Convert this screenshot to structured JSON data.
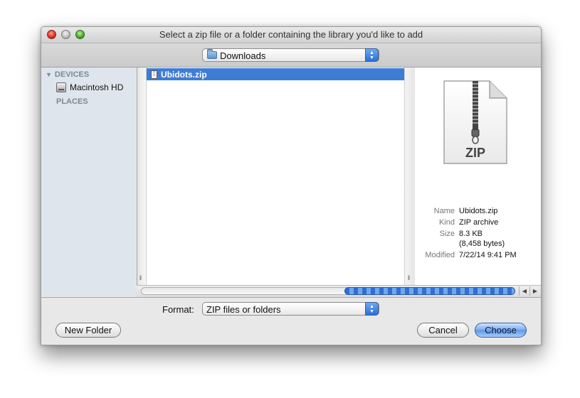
{
  "window": {
    "title": "Select a zip file or a folder containing the library you'd like to add"
  },
  "toolbar": {
    "location_popup": "Downloads"
  },
  "sidebar": {
    "devices_header": "DEVICES",
    "devices_items": [
      {
        "label": "Macintosh HD",
        "icon": "hard-drive-icon"
      }
    ],
    "places_header": "PLACES"
  },
  "files": [
    {
      "name": "Ubidots.zip",
      "selected": true,
      "icon": "zip-file-icon"
    }
  ],
  "preview": {
    "icon_label": "ZIP",
    "info": [
      {
        "key": "Name",
        "value": "Ubidots.zip"
      },
      {
        "key": "Kind",
        "value": "ZIP archive"
      },
      {
        "key": "Size",
        "value": "8.3 KB"
      },
      {
        "key": "",
        "value": "(8,458 bytes)"
      },
      {
        "key": "Modified",
        "value": "7/22/14 9:41 PM"
      }
    ]
  },
  "bottom": {
    "format_label": "Format:",
    "format_value": "ZIP files or folders",
    "new_folder": "New Folder",
    "cancel": "Cancel",
    "choose": "Choose"
  },
  "colors": {
    "selection": "#3e7dd6",
    "sidebar_bg": "#dfe5ec",
    "accent_button": "#5b97ec"
  }
}
